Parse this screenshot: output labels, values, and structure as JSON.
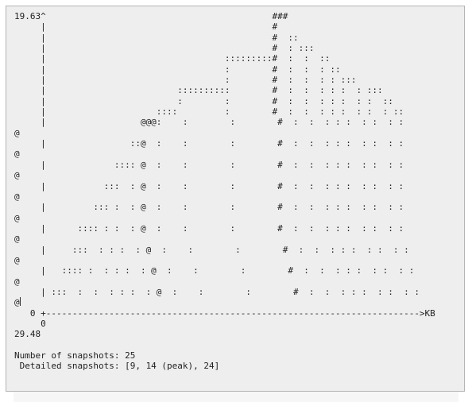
{
  "massif_output": {
    "graph_lines": [
      "19.63^                                           ###",
      "     |                                           #",
      "     |                                           #  ::",
      "     |                                           #  : :::",
      "     |                                  :::::::::#  :  :  ::",
      "     |                                  :        #  :  :  : ::",
      "     |                                  :        #  :  :  : : :::",
      "     |                         ::::::::::        #  :  :  : : :  : :::",
      "     |                         :        :        #  :  :  : : :  : :  ::",
      "     |                     ::::         :        #  :  :  : : :  : :  : ::",
      "     |                  @@@:    :        :        #  :  :  : : :  : :  : :",
      "@",
      "     |                ::@  :    :        :        #  :  :  : : :  : :  : :",
      "@",
      "     |             :::: @  :    :        :        #  :  :  : : :  : :  : :",
      "@",
      "     |           :::  : @  :    :        :        #  :  :  : : :  : :  : :",
      "@",
      "     |         ::: :  : @  :    :        :        #  :  :  : : :  : :  : :",
      "@",
      "     |      :::: : :  : @  :    :        :        #  :  :  : : :  : :  : :",
      "@",
      "     |     :::  : : :  : @  :    :        :        #  :  :  : : :  : :  : :",
      "@",
      "     |   :::: :  : : :  : @  :    :        :        #  :  :  : : :  : :  : :",
      "@",
      "     | :::  :  :  : : :  : @  :    :        :        #  :  :  : : :  : :  : :",
      "@",
      "   0 +----------------------------------------------------------------------->KB",
      "     0",
      "29.48",
      "",
      "Number of snapshots: 25",
      " Detailed snapshots: [9, 14 (peak), 24]"
    ]
  }
}
